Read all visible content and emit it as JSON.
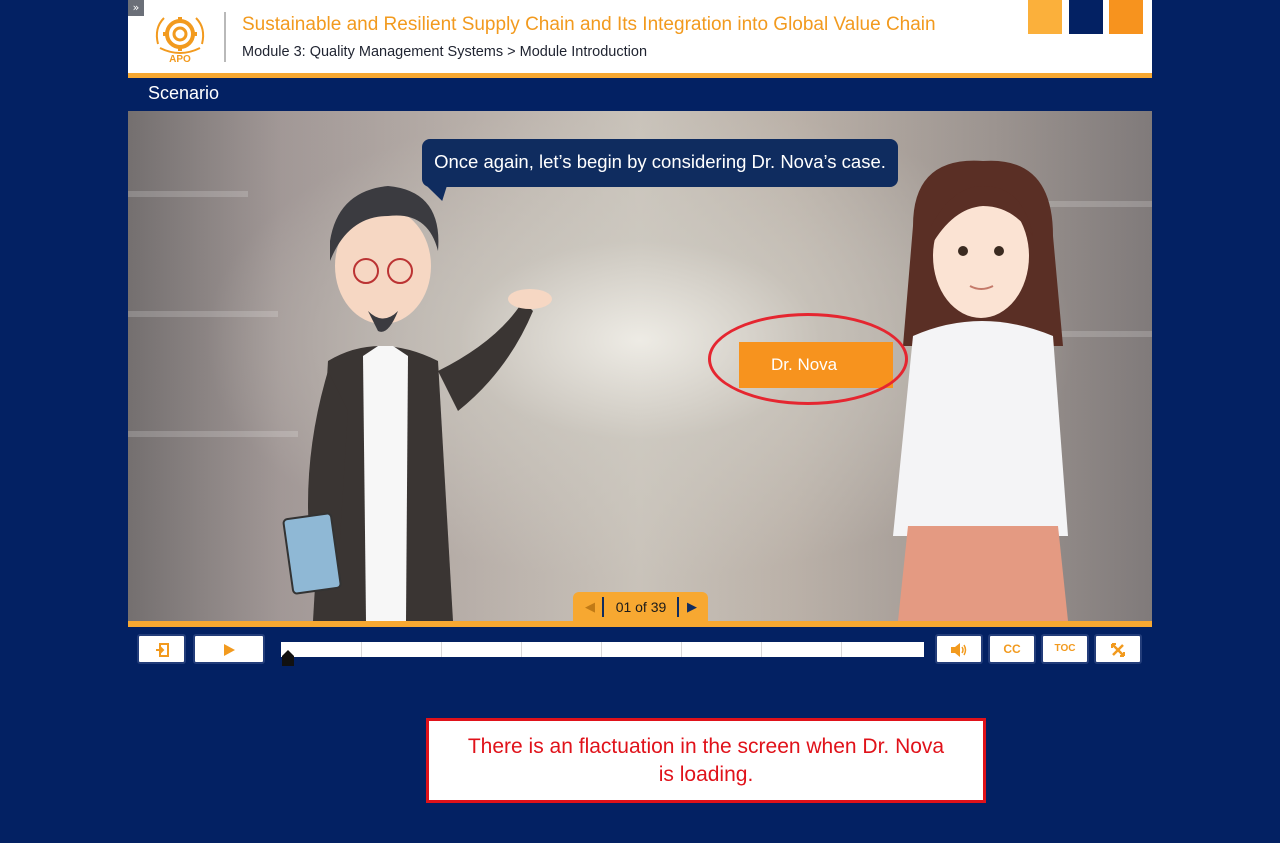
{
  "header": {
    "course_title": "Sustainable and Resilient Supply Chain and Its Integration into Global Value Chain",
    "breadcrumb": "Module 3: Quality Management Systems > Module Introduction",
    "logo_text": "APO",
    "expand_icon": "»",
    "swatch_colors": [
      "#fbb03b",
      "#032163",
      "#f7931e"
    ]
  },
  "section": {
    "label": "Scenario"
  },
  "slide": {
    "speech_text": "Once again, let’s begin by considering Dr. Nova’s case.",
    "name_tag": "Dr. Nova",
    "counter": "01 of 39"
  },
  "controls": {
    "exit_icon": "exit-icon",
    "play_icon": "play-icon",
    "volume_icon": "volume-icon",
    "cc_label": "CC",
    "toc_label": "TOC",
    "fullscreen_icon": "fullscreen-icon",
    "progress": 0.01
  },
  "annotation": {
    "text": "There is an flactuation in the screen when Dr. Nova is loading."
  },
  "colors": {
    "background": "#032163",
    "accent": "#f7a831",
    "title": "#f29a1e",
    "annotation": "#e0121a"
  }
}
